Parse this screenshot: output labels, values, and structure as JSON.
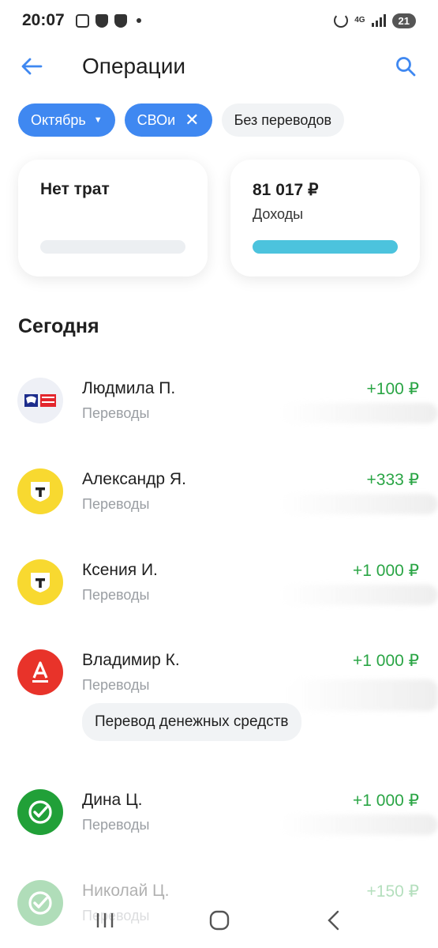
{
  "status_bar": {
    "time": "20:07",
    "network": "4G",
    "battery": "21"
  },
  "header": {
    "title": "Операции"
  },
  "filters": [
    {
      "label": "Октябрь"
    },
    {
      "label": "СВОи"
    },
    {
      "label": "Без переводов"
    }
  ],
  "summary": {
    "spend": {
      "title": "Нет трат",
      "progress": 0
    },
    "income": {
      "amount": "81 017 ₽",
      "label": "Доходы",
      "progress": 1.0
    }
  },
  "section": {
    "title": "Сегодня"
  },
  "transactions": [
    {
      "name": "Людмила П.",
      "category": "Переводы",
      "amount": "+100 ₽",
      "bank_icon": "pochta-bank-logo"
    },
    {
      "name": "Александр Я.",
      "category": "Переводы",
      "amount": "+333 ₽",
      "bank_icon": "tinkoff-logo"
    },
    {
      "name": "Ксения И.",
      "category": "Переводы",
      "amount": "+1 000 ₽",
      "bank_icon": "tinkoff-logo"
    },
    {
      "name": "Владимир К.",
      "category": "Переводы",
      "amount": "+1 000 ₽",
      "bank_icon": "alfa-bank-logo",
      "note": "Перевод денежных средств"
    },
    {
      "name": "Дина Ц.",
      "category": "Переводы",
      "amount": "+1 000 ₽",
      "bank_icon": "sber-logo"
    },
    {
      "name": "Николай Ц.",
      "category": "Переводы",
      "amount": "+150 ₽",
      "bank_icon": "sber-logo"
    }
  ],
  "colors": {
    "accent": "#3f88f1",
    "income_green": "#2aa545",
    "income_bar": "#4cc3dd"
  }
}
